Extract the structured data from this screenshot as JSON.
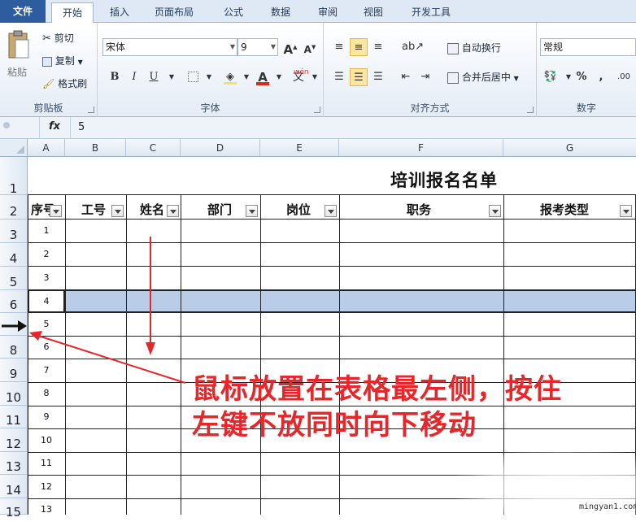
{
  "tabs": [
    "文件",
    "开始",
    "插入",
    "页面布局",
    "公式",
    "数据",
    "审阅",
    "视图",
    "开发工具"
  ],
  "clipboard": {
    "paste": "粘贴",
    "cut": "剪切",
    "copy": "复制",
    "format_painter": "格式刷",
    "label": "剪贴板"
  },
  "font": {
    "name": "宋体",
    "size": "9",
    "bold": "B",
    "italic": "I",
    "underline": "U",
    "label": "字体",
    "color_letter": "A"
  },
  "alignment": {
    "wrap": "自动换行",
    "merge": "合并后居中",
    "label": "对齐方式"
  },
  "number": {
    "format": "常规",
    "percent": "%",
    "comma": ",",
    "label": "数字"
  },
  "formula_bar": {
    "fx": "fx",
    "value": "5"
  },
  "columns": [
    "A",
    "B",
    "C",
    "D",
    "E",
    "F",
    "G"
  ],
  "rows": [
    "1",
    "2",
    "3",
    "4",
    "5",
    "6",
    "7",
    "8",
    "9",
    "10",
    "11",
    "12",
    "13",
    "14",
    "15"
  ],
  "sheet": {
    "title": "培训报名名单",
    "headers": {
      "seq": "序号",
      "emp_id": "工号",
      "name": "姓名",
      "dept": "部门",
      "post": "岗位",
      "duty": "职务",
      "exam_type": "报考类型"
    },
    "seq_values": [
      "1",
      "2",
      "3",
      "4",
      "5",
      "6",
      "7",
      "8",
      "9",
      "10",
      "11",
      "12",
      "13"
    ]
  },
  "annotation": {
    "line1": "鼠标放置在表格最左侧，按住",
    "line2": "左键不放同时向下移动"
  },
  "watermark": "mingyan1.com",
  "colors": {
    "highlight_row": "#b9cce8",
    "annotation": "#e8262a",
    "file_tab": "#2d5d9f"
  }
}
